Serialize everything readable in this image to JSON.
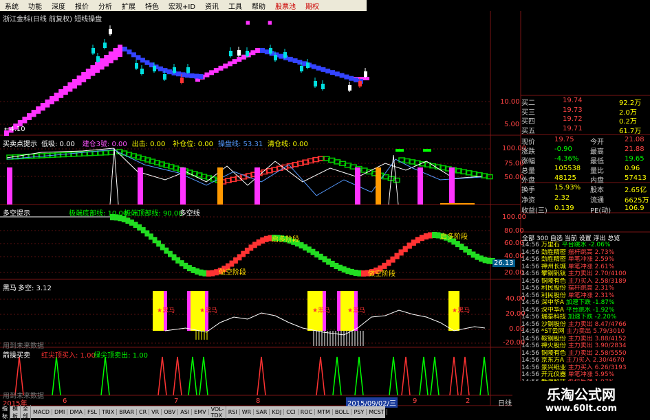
{
  "menu": [
    "系统",
    "功能",
    "深度",
    "报价",
    "分析",
    "扩展",
    "特色",
    "宏观+ID",
    "资讯",
    "工具",
    "帮助",
    "股票池",
    "期权"
  ],
  "chart_title": "浙江金科(日线 前复权) 短线操盘",
  "price_axis": [
    "10.00",
    "5.00"
  ],
  "low_marker": "←4.10",
  "panel1": {
    "name": "买卖点提示",
    "items": [
      {
        "label": "低吸: 0.00",
        "color": "#ffffff"
      },
      {
        "label": "建仓3號: 0.00",
        "color": "#ff55ff"
      },
      {
        "label": "出击: 0.00",
        "color": "#ffff00"
      },
      {
        "label": "补仓位: 0.00",
        "color": "#ffff00"
      },
      {
        "label": "操盘线: 53.31",
        "color": "#5599ff"
      },
      {
        "label": "清仓线: 0.00",
        "color": "#ffff00"
      }
    ],
    "axis": [
      "100.00",
      "75.00",
      "50.00"
    ]
  },
  "panel2": {
    "name": "多空提示",
    "items": [
      {
        "label": "极端底部线: 10.00",
        "color": "#00ff00"
      },
      {
        "label": "极端顶部线: 90.00",
        "color": "#00ff00"
      },
      {
        "label": "多空线",
        "color": "#ffffff"
      }
    ],
    "axis": [
      "100.00",
      "80.00",
      "60.00",
      "40.00",
      "20.00"
    ],
    "current": "26.13",
    "texts": [
      "做空阶段",
      "启多阶段"
    ]
  },
  "panel3": {
    "name": "黑马",
    "item": "多空: 3.12",
    "axis": [
      "40.00",
      "20.00",
      "0.00",
      "-20.00"
    ],
    "mark": "★黑马",
    "footer": "用到未来数据"
  },
  "panel4": {
    "name": "箭操买卖",
    "items": [
      {
        "label": "红尖顶买入: 1.00",
        "color": "#ff3333"
      },
      {
        "label": "绿尖顶卖出: 1.00",
        "color": "#00ff00"
      }
    ],
    "footer": "用到未来数据"
  },
  "date_axis": {
    "year": "2015年",
    "labels": [
      "6",
      "7",
      "8",
      "9",
      "2"
    ],
    "highlight": "2015/09/02/三",
    "period": "日线"
  },
  "quote": [
    [
      "买二",
      "19.74",
      "92.2万"
    ],
    [
      "买三",
      "19.73",
      "2.0万"
    ],
    [
      "买四",
      "19.72",
      "0.2万"
    ],
    [
      "买五",
      "19.71",
      "61.7万"
    ]
  ],
  "stats": [
    [
      "现价",
      "19.75",
      "今开",
      "21.08"
    ],
    [
      "涨跌",
      "-0.90",
      "最高",
      "21.88"
    ],
    [
      "涨幅",
      "-4.36%",
      "最低",
      "19.65"
    ],
    [
      "总量",
      "105538",
      "量比",
      "0.96"
    ],
    [
      "外盘",
      "48125",
      "内盘",
      "57413"
    ],
    [
      "换手",
      "15.93%",
      "股本",
      "2.65亿"
    ],
    [
      "净资",
      "2.32",
      "流通",
      "6625万"
    ],
    [
      "收益(三)",
      "0.139",
      "PE(动)",
      "106.9"
    ]
  ],
  "tick_tabs": "全部 300 自选 当前 设置 浮出 总览",
  "ticks": [
    [
      "14:56",
      "万里石",
      "平台跳水",
      "-2.06%"
    ],
    [
      "14:56",
      "劲胜精密",
      "摆杆跳高",
      "2.73%"
    ],
    [
      "14:56",
      "劲胜精密",
      "单笔冲涨",
      "2.59%"
    ],
    [
      "14:56",
      "神州长城",
      "单笔冲涨",
      "2.61%"
    ],
    [
      "14:56",
      "攀钢钒钛",
      "主力卖出",
      "2.70/4100"
    ],
    [
      "14:56",
      "铜陵有色",
      "主力买入",
      "2.58/3189"
    ],
    [
      "14:56",
      "利民股份",
      "摆杆跳高",
      "2.31%"
    ],
    [
      "14:56",
      "利民股份",
      "单笔冲涨",
      "2.31%"
    ],
    [
      "14:56",
      "深中华A",
      "加速下跌",
      "-1.87%"
    ],
    [
      "14:56",
      "深中华A",
      "平台跳水",
      "-1.92%"
    ],
    [
      "14:56",
      "瑞泰科技",
      "加速下跌",
      "-2.20%"
    ],
    [
      "14:56",
      "沙钢股份",
      "主力卖出",
      "8.47/4766"
    ],
    [
      "14:56",
      "*ST云网",
      "主力卖出",
      "5.79/3010"
    ],
    [
      "14:56",
      "鞍钢股份",
      "主力卖出",
      "3.88/4152"
    ],
    [
      "14:56",
      "神火股份",
      "主力卖出",
      "3.90/2834"
    ],
    [
      "14:56",
      "铜陵有色",
      "主力卖出",
      "2.58/5550"
    ],
    [
      "14:56",
      "京东方A",
      "主力买入",
      "2.30/4670"
    ],
    [
      "14:56",
      "景兴纸业",
      "主力买入",
      "6.26/3193"
    ],
    [
      "14:56",
      "开元仪器",
      "单笔冲涨",
      "5.95%"
    ],
    [
      "14:56",
      "新海科技",
      "低位反弹",
      "1.97%"
    ]
  ],
  "tabs": [
    "指标",
    "模板",
    "全部",
    "MACD",
    "DMI",
    "DMA",
    "FSL",
    "TRIX",
    "BRAR",
    "CR",
    "VR",
    "OBV",
    "ASI",
    "EMV",
    "VOL-TDX",
    "RSI",
    "WR",
    "SAR",
    "KDJ",
    "CCI",
    "ROC",
    "MTM",
    "BOLL",
    "PSY",
    "MCST"
  ],
  "watermark": {
    "line1": "乐淘公式网",
    "line2": "www.60lt.com"
  },
  "colors": {
    "up": "#ff3333",
    "down": "#00ff00",
    "border": "#7a1515",
    "text_green": "#00ff00",
    "text_red": "#ff4444",
    "text_yellow": "#ffff00"
  }
}
